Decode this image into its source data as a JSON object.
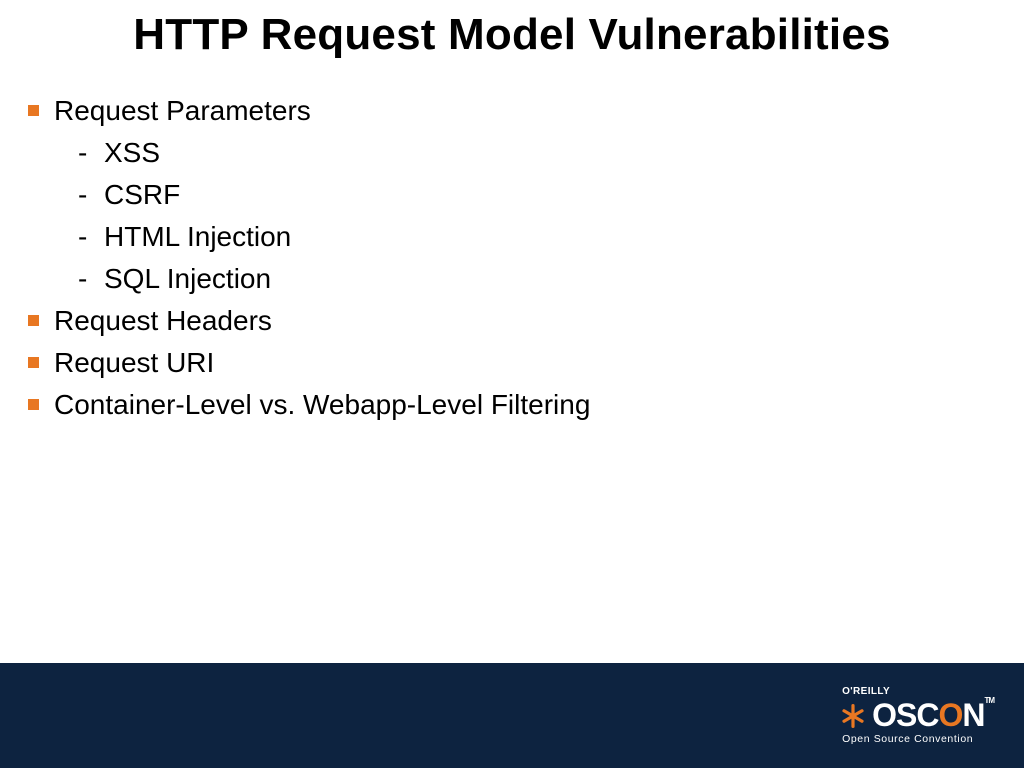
{
  "title": "HTTP Request Model Vulnerabilities",
  "bullets": {
    "b1": "Request Parameters",
    "b1_sub": {
      "s1": "XSS",
      "s2": "CSRF",
      "s3": "HTML Injection",
      "s4": "SQL Injection"
    },
    "b2": "Request Headers",
    "b3": "Request URI",
    "b4": "Container-Level vs. Webapp-Level Filtering"
  },
  "footer": {
    "publisher": "O'REILLY",
    "brand": "OSC",
    "brand_accent": "O",
    "brand_suffix": "N",
    "tagline": "Open Source Convention"
  }
}
